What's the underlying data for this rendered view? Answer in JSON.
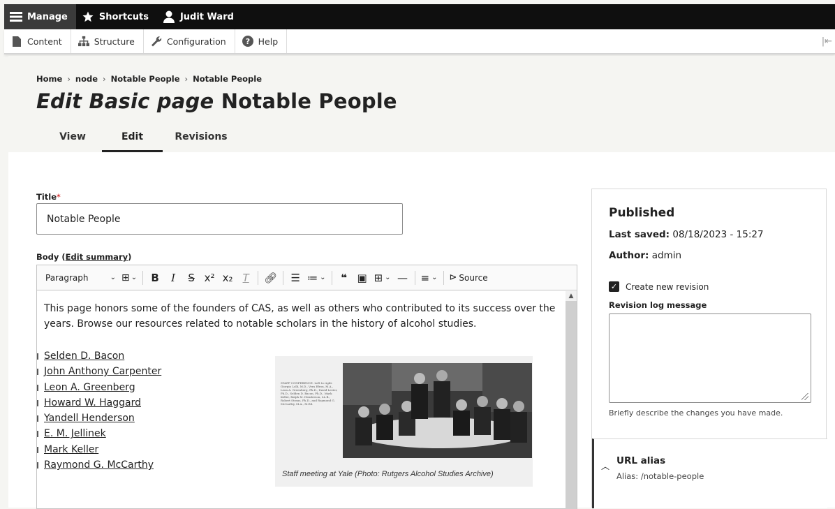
{
  "toolbar": {
    "manage": "Manage",
    "shortcuts": "Shortcuts",
    "user": "Judit Ward"
  },
  "tray": {
    "content": "Content",
    "structure": "Structure",
    "configuration": "Configuration",
    "help": "Help"
  },
  "breadcrumb": {
    "items": [
      "Home",
      "node",
      "Notable People",
      "Notable People"
    ],
    "separator": "›"
  },
  "page": {
    "title_italic": "Edit Basic page",
    "title_rest": "Notable People"
  },
  "tabs": [
    "View",
    "Edit",
    "Revisions"
  ],
  "form": {
    "title_label": "Title",
    "required_mark": "*",
    "title_value": "Notable People",
    "body_label": "Body (",
    "edit_summary": "Edit summary",
    "body_label_close": ")"
  },
  "editor": {
    "paragraph_format": "Paragraph",
    "source_label": "Source",
    "intro": "This page honors some of the founders of CAS, as well as others who contributed to its success over the years. Browse our resources related to notable scholars in the history of alcohol studies.",
    "people": [
      "Selden D. Bacon",
      "John Anthony Carpenter",
      "Leon A. Greenberg",
      "Howard W. Haggard",
      "Yandell Henderson",
      "E. M. Jellinek",
      "Mark Keller",
      "Raymond G. McCarthy"
    ],
    "figure_caption": "Staff meeting at Yale (Photo: Rutgers Alcohol Studies Archive)",
    "photo_text": "STAFF CONFERENCE. Left to right: Giorgio Lolli, M.D., Vera Efron, M.A., Leon A. Greenberg, Ph.D., David Lester, Ph.D., Selden D. Bacon, Ph.D., Mark Keller, Ralph M. Henderson, LL.B., Robert Straus, Ph.D., and Raymond G. McCarthy, M.A., M.Ed."
  },
  "sidebar": {
    "status": "Published",
    "last_saved_label": "Last saved:",
    "last_saved_value": "08/18/2023 - 15:27",
    "author_label": "Author:",
    "author_value": "admin",
    "create_revision": "Create new revision",
    "revision_log_label": "Revision log message",
    "revision_hint": "Briefly describe the changes you have made.",
    "url_alias_title": "URL alias",
    "url_alias_summary": "Alias: /notable-people"
  }
}
